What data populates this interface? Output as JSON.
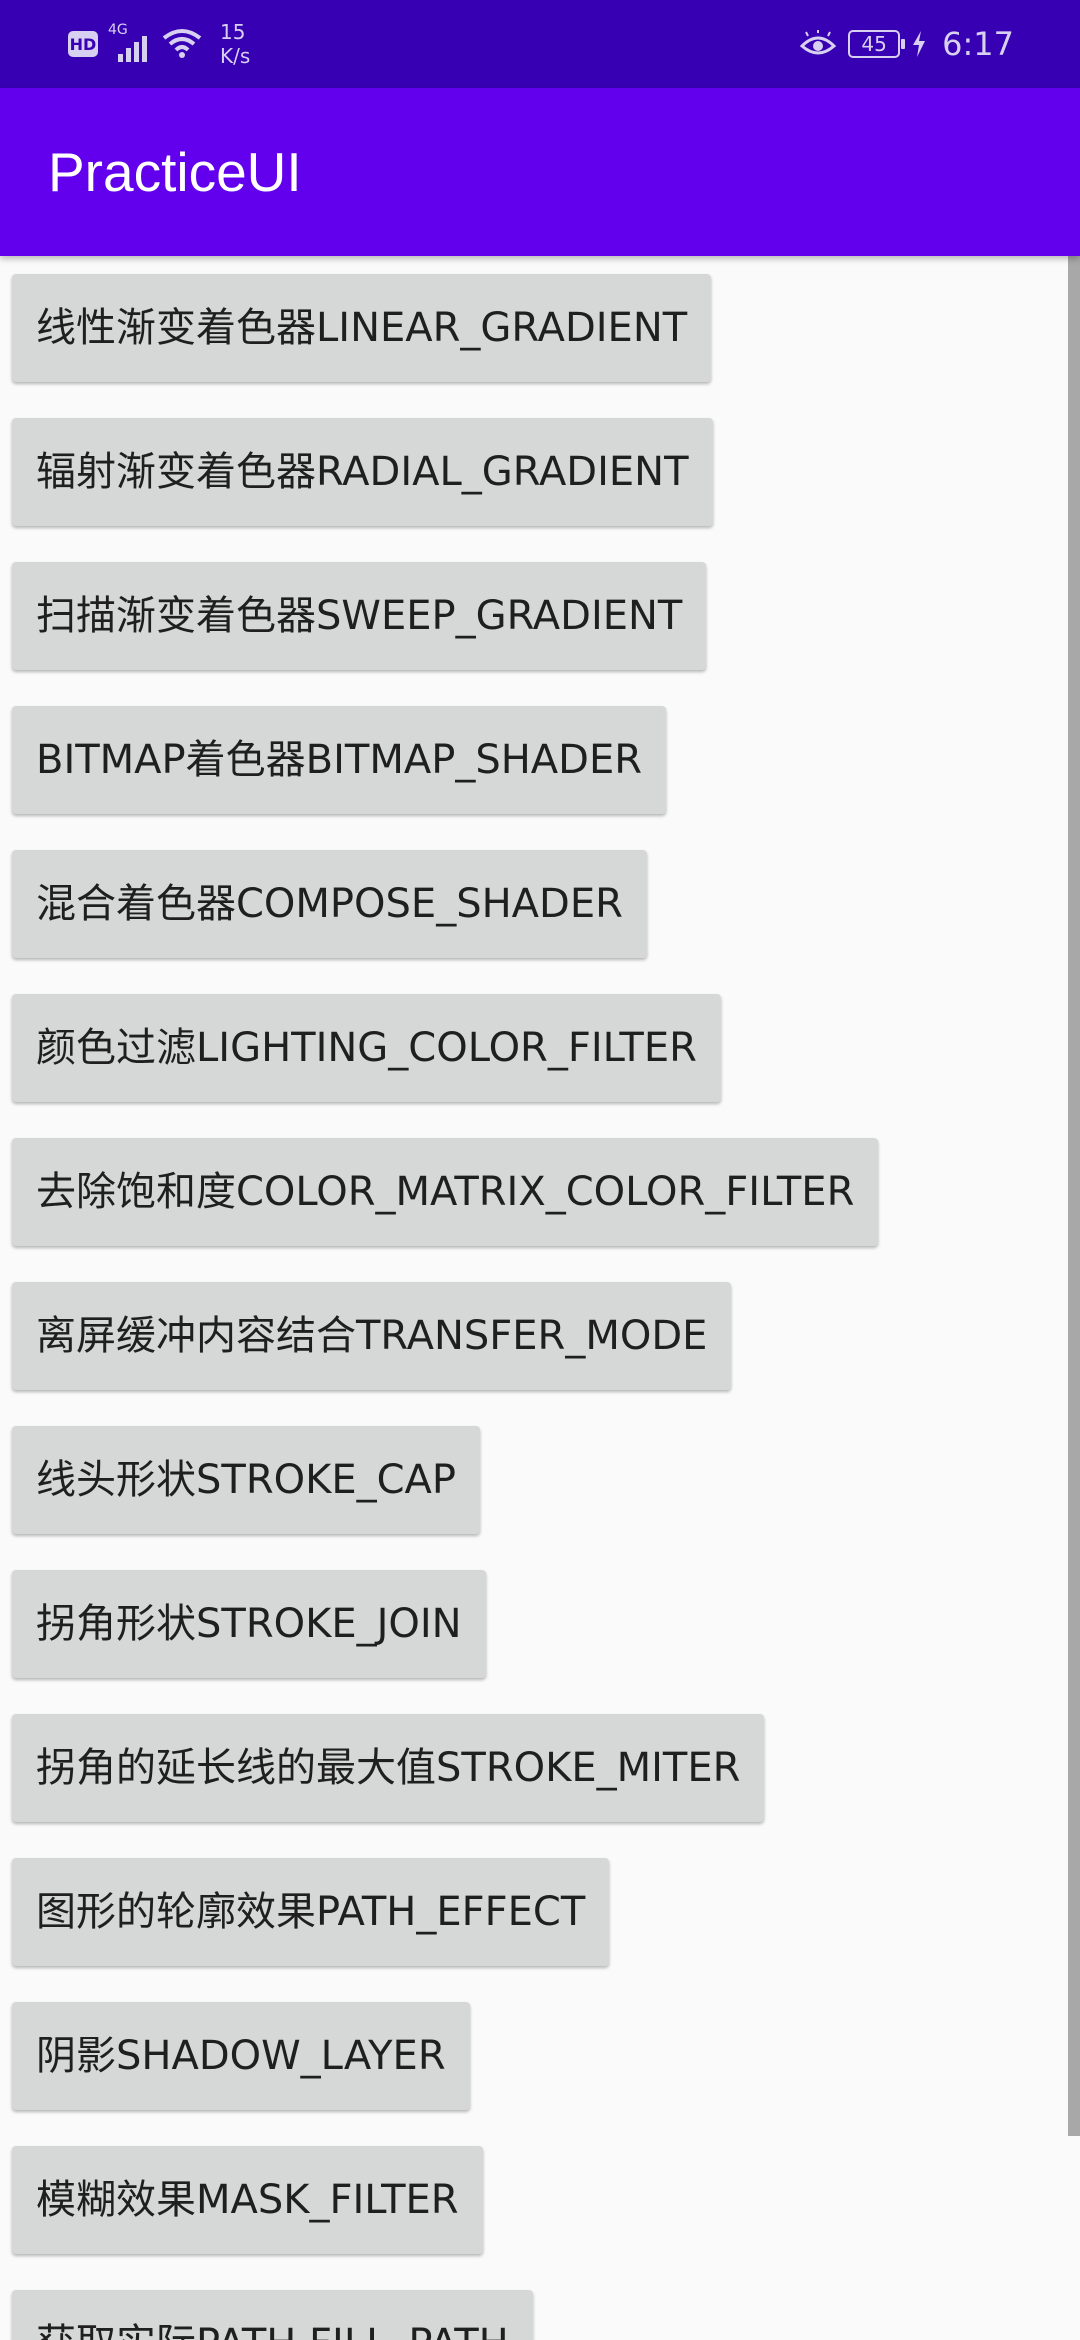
{
  "status_bar": {
    "hd": "HD",
    "network": "4G",
    "speed_value": "15",
    "speed_unit": "K/s",
    "battery": "45",
    "time": "6:17",
    "icons": [
      "hd-icon",
      "signal-icon",
      "wifi-icon",
      "eye-icon",
      "battery-icon",
      "charging-icon"
    ]
  },
  "app_bar": {
    "title": "PracticeUI"
  },
  "buttons": [
    {
      "label": "线性渐变着色器LINEAR_GRADIENT"
    },
    {
      "label": "辐射渐变着色器RADIAL_GRADIENT"
    },
    {
      "label": "扫描渐变着色器SWEEP_GRADIENT"
    },
    {
      "label": "BITMAP着色器BITMAP_SHADER"
    },
    {
      "label": "混合着色器COMPOSE_SHADER"
    },
    {
      "label": "颜色过滤LIGHTING_COLOR_FILTER"
    },
    {
      "label": "去除饱和度COLOR_MATRIX_COLOR_FILTER"
    },
    {
      "label": "离屏缓冲内容结合TRANSFER_MODE"
    },
    {
      "label": "线头形状STROKE_CAP"
    },
    {
      "label": "拐角形状STROKE_JOIN"
    },
    {
      "label": "拐角的延长线的最大值STROKE_MITER"
    },
    {
      "label": "图形的轮廓效果PATH_EFFECT"
    },
    {
      "label": "阴影SHADOW_LAYER"
    },
    {
      "label": "模糊效果MASK_FILTER"
    },
    {
      "label": "获取实际PATH FILL_PATH"
    }
  ],
  "colors": {
    "status_bar": "#3700b3",
    "app_bar": "#6200ee",
    "button_bg": "#d6d7d7",
    "background": "#fafafa"
  }
}
